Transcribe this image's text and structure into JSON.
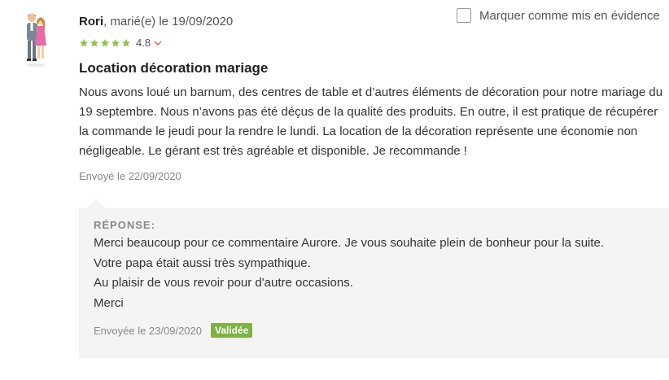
{
  "review": {
    "author_name": "Rori",
    "author_meta": ", marié(e) le 19/09/2020",
    "rating": "4.8",
    "feature_label": "Marquer comme mis en évidence",
    "title": "Location décoration mariage",
    "body": "Nous avons loué un barnum, des centres de table et d’autres éléments de décoration pour notre mariage du 19 septembre. Nous n’avons pas été déçus de la qualité des produits. En outre, il est pratique de récupérer la commande le jeudi pour la rendre le lundi. La location de la décoration représente une économie non négligeable. Le gérant est très agréable et disponible. Je recommande !",
    "sent_date": "Envoyé le 22/09/2020"
  },
  "reply": {
    "label": "RÉPONSE:",
    "lines": [
      "Merci beaucoup pour ce commentaire Aurore. Je vous souhaite plein de bonheur pour la suite.",
      "Votre papa était aussi très sympathique.",
      "Au plaisir de vous revoir pour d'autre occasions.",
      "Merci"
    ],
    "sent_date": "Envoyée le 23/09/2020",
    "status": "Validée"
  },
  "colors": {
    "star": "#8bc34a",
    "badge": "#7cb342",
    "reply_bg": "#f4f4f4"
  }
}
